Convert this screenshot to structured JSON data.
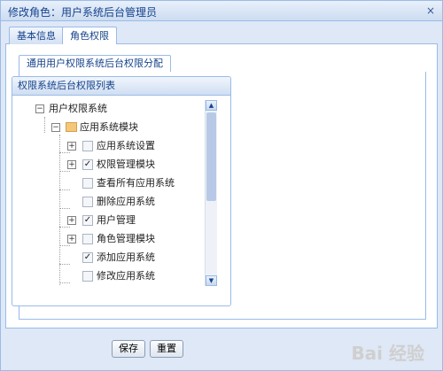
{
  "window": {
    "title": "修改角色：用户系统后台管理员",
    "close_icon": "×"
  },
  "tabs": [
    {
      "label": "基本信息",
      "active": false
    },
    {
      "label": "角色权限",
      "active": true
    }
  ],
  "subtab": {
    "label": "通用用户权限系统后台权限分配"
  },
  "tree_panel": {
    "title": "权限系统后台权限列表"
  },
  "tree": {
    "root": {
      "label": "用户权限系统",
      "expander": "−"
    },
    "module": {
      "label": "应用系统模块",
      "expander": "−"
    },
    "items": [
      {
        "label": "应用系统设置",
        "expander": "+",
        "checked": false
      },
      {
        "label": "权限管理模块",
        "expander": "+",
        "checked": true
      },
      {
        "label": "查看所有应用系统",
        "expander": "",
        "checked": false
      },
      {
        "label": "删除应用系统",
        "expander": "",
        "checked": false
      },
      {
        "label": "用户管理",
        "expander": "+",
        "checked": true
      },
      {
        "label": "角色管理模块",
        "expander": "+",
        "checked": false
      },
      {
        "label": "添加应用系统",
        "expander": "",
        "checked": true
      },
      {
        "label": "修改应用系统",
        "expander": "",
        "checked": false
      }
    ]
  },
  "scrollbar": {
    "up_icon": "▲",
    "down_icon": "▼"
  },
  "buttons": {
    "save": "保存",
    "reset": "重置"
  },
  "watermark": "Bai 经验"
}
